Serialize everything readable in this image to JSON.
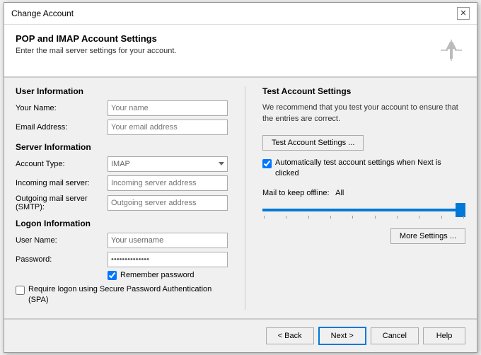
{
  "dialog": {
    "title": "Change Account",
    "close_icon": "✕"
  },
  "header": {
    "heading": "POP and IMAP Account Settings",
    "subtext": "Enter the mail server settings for your account.",
    "icon": "✳"
  },
  "left": {
    "user_info_title": "User Information",
    "your_name_label": "Your Name:",
    "your_name_placeholder": "Your name",
    "email_label": "Email Address:",
    "email_placeholder": "Your email address",
    "server_info_title": "Server Information",
    "account_type_label": "Account Type:",
    "account_type_value": "IMAP",
    "incoming_label": "Incoming mail server:",
    "incoming_placeholder": "Incoming server address",
    "outgoing_label": "Outgoing mail server (SMTP):",
    "outgoing_placeholder": "Outgoing server address",
    "logon_title": "Logon Information",
    "username_label": "User Name:",
    "username_value": "Your username",
    "password_label": "Password:",
    "password_value": "**************",
    "remember_password_label": "Remember password",
    "require_spa_label": "Require logon using Secure Password Authentication (SPA)"
  },
  "right": {
    "test_section_title": "Test Account Settings",
    "test_desc": "We recommend that you test your account to ensure that the entries are correct.",
    "test_btn_label": "Test Account Settings ...",
    "auto_test_label": "Automatically test account settings when Next is clicked",
    "mail_offline_label": "Mail to keep offline:",
    "mail_offline_value": "All",
    "more_settings_label": "More Settings ..."
  },
  "footer": {
    "back_label": "< Back",
    "next_label": "Next >",
    "cancel_label": "Cancel",
    "help_label": "Help"
  }
}
